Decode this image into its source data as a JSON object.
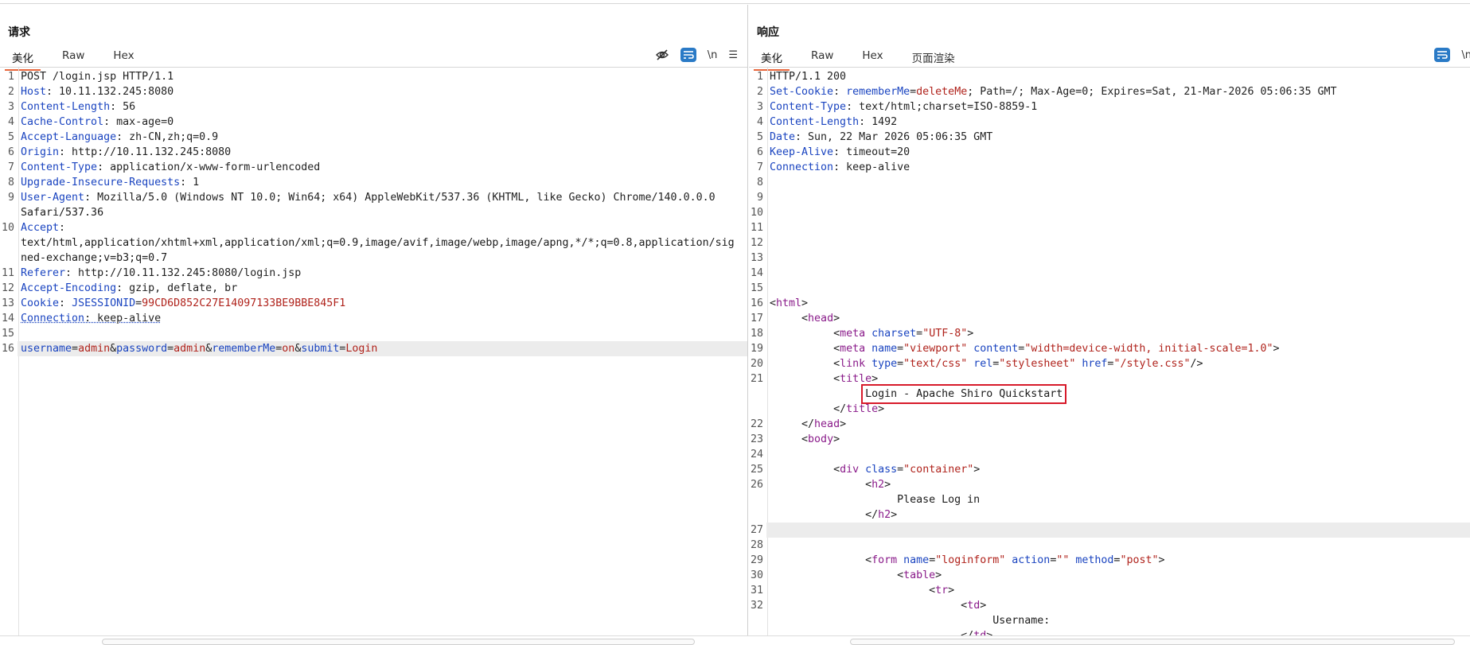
{
  "request": {
    "title": "请求",
    "tabs": [
      "美化",
      "Raw",
      "Hex"
    ],
    "tools": {
      "eye_off": "eye-off-icon",
      "wrap": "wrap-icon",
      "newline": "\\n",
      "menu": "☰"
    },
    "lines": [
      {
        "n": "1",
        "segs": [
          [
            "v",
            "POST /login.jsp HTTP/1.1"
          ]
        ]
      },
      {
        "n": "2",
        "segs": [
          [
            "k",
            "Host"
          ],
          [
            "v",
            ": 10.11.132.245:8080"
          ]
        ]
      },
      {
        "n": "3",
        "segs": [
          [
            "k",
            "Content-Length"
          ],
          [
            "v",
            ": 56"
          ]
        ]
      },
      {
        "n": "4",
        "segs": [
          [
            "k",
            "Cache-Control"
          ],
          [
            "v",
            ": max-age=0"
          ]
        ]
      },
      {
        "n": "5",
        "segs": [
          [
            "k",
            "Accept-Language"
          ],
          [
            "v",
            ": zh-CN,zh;q=0.9"
          ]
        ]
      },
      {
        "n": "6",
        "segs": [
          [
            "k",
            "Origin"
          ],
          [
            "v",
            ": http://10.11.132.245:8080"
          ]
        ]
      },
      {
        "n": "7",
        "segs": [
          [
            "k",
            "Content-Type"
          ],
          [
            "v",
            ": application/x-www-form-urlencoded"
          ]
        ]
      },
      {
        "n": "8",
        "segs": [
          [
            "k",
            "Upgrade-Insecure-Requests"
          ],
          [
            "v",
            ": 1"
          ]
        ]
      },
      {
        "n": "9",
        "segs": [
          [
            "k",
            "User-Agent"
          ],
          [
            "v",
            ": Mozilla/5.0 (Windows NT 10.0; Win64; x64) AppleWebKit/537.36 (KHTML, like Gecko) Chrome/140.0.0.0"
          ]
        ],
        "cont": [
          "Safari/537.36"
        ]
      },
      {
        "n": "10",
        "segs": [
          [
            "k",
            "Accept"
          ],
          [
            "v",
            ":"
          ]
        ],
        "cont": [
          "text/html,application/xhtml+xml,application/xml;q=0.9,image/avif,image/webp,image/apng,*/*;q=0.8,application/sig",
          "ned-exchange;v=b3;q=0.7"
        ]
      },
      {
        "n": "11",
        "segs": [
          [
            "k",
            "Referer"
          ],
          [
            "v",
            ": http://10.11.132.245:8080/login.jsp"
          ]
        ]
      },
      {
        "n": "12",
        "segs": [
          [
            "k",
            "Accept-Encoding"
          ],
          [
            "v",
            ": gzip, deflate, br"
          ]
        ]
      },
      {
        "n": "13",
        "segs": [
          [
            "k",
            "Cookie"
          ],
          [
            "v",
            ": "
          ],
          [
            "k",
            "JSESSIONID"
          ],
          [
            "v",
            "="
          ],
          [
            "r",
            "99CD6D852C27E14097133BE9BBE845F1"
          ]
        ]
      },
      {
        "n": "14",
        "segs": [
          [
            "k ul",
            "Connection"
          ],
          [
            "v ul",
            ": keep-alive"
          ]
        ]
      },
      {
        "n": "15",
        "segs": [
          [
            "v",
            ""
          ]
        ]
      },
      {
        "n": "16",
        "hl": true,
        "segs": [
          [
            "k",
            "username"
          ],
          [
            "v",
            "="
          ],
          [
            "r",
            "admin"
          ],
          [
            "v",
            "&"
          ],
          [
            "k",
            "password"
          ],
          [
            "v",
            "="
          ],
          [
            "r",
            "admin"
          ],
          [
            "v",
            "&"
          ],
          [
            "k",
            "rememberMe"
          ],
          [
            "v",
            "="
          ],
          [
            "r",
            "on"
          ],
          [
            "v",
            "&"
          ],
          [
            "k",
            "submit"
          ],
          [
            "v",
            "="
          ],
          [
            "r",
            "Login"
          ]
        ]
      }
    ]
  },
  "response": {
    "title": "响应",
    "tabs": [
      "美化",
      "Raw",
      "Hex",
      "页面渲染"
    ],
    "tools": {
      "wrap": "wrap-icon",
      "newline": "\\n"
    },
    "lines": [
      {
        "n": "1",
        "segs": [
          [
            "v",
            "HTTP/1.1 200"
          ]
        ]
      },
      {
        "n": "2",
        "segs": [
          [
            "k",
            "Set-Cookie"
          ],
          [
            "v",
            ": "
          ],
          [
            "k",
            "rememberMe"
          ],
          [
            "v",
            "="
          ],
          [
            "r",
            "deleteMe"
          ],
          [
            "v",
            "; Path=/; Max-Age=0; Expires=Sat, 21-Mar-2026 05:06:35 GMT"
          ]
        ]
      },
      {
        "n": "3",
        "segs": [
          [
            "k",
            "Content-Type"
          ],
          [
            "v",
            ": text/html;charset=ISO-8859-1"
          ]
        ]
      },
      {
        "n": "4",
        "segs": [
          [
            "k",
            "Content-Length"
          ],
          [
            "v",
            ": 1492"
          ]
        ]
      },
      {
        "n": "5",
        "segs": [
          [
            "k",
            "Date"
          ],
          [
            "v",
            ": Sun, 22 Mar 2026 05:06:35 GMT"
          ]
        ]
      },
      {
        "n": "6",
        "segs": [
          [
            "k",
            "Keep-Alive"
          ],
          [
            "v",
            ": timeout=20"
          ]
        ]
      },
      {
        "n": "7",
        "segs": [
          [
            "k",
            "Connection"
          ],
          [
            "v",
            ": keep-alive"
          ]
        ]
      },
      {
        "n": "8",
        "segs": [
          [
            "v",
            ""
          ]
        ]
      },
      {
        "n": "9",
        "segs": [
          [
            "v",
            ""
          ]
        ]
      },
      {
        "n": "10",
        "segs": [
          [
            "v",
            ""
          ]
        ]
      },
      {
        "n": "11",
        "segs": [
          [
            "v",
            ""
          ]
        ]
      },
      {
        "n": "12",
        "segs": [
          [
            "v",
            ""
          ]
        ]
      },
      {
        "n": "13",
        "segs": [
          [
            "v",
            ""
          ]
        ]
      },
      {
        "n": "14",
        "segs": [
          [
            "v",
            ""
          ]
        ]
      },
      {
        "n": "15",
        "segs": [
          [
            "v",
            ""
          ]
        ]
      },
      {
        "n": "16",
        "segs": [
          [
            "p",
            "<"
          ],
          [
            "tag",
            "html"
          ],
          [
            "p",
            ">"
          ]
        ]
      },
      {
        "n": "17",
        "segs": [
          [
            "v",
            "     "
          ],
          [
            "p",
            "<"
          ],
          [
            "tag",
            "head"
          ],
          [
            "p",
            ">"
          ]
        ]
      },
      {
        "n": "18",
        "segs": [
          [
            "v",
            "          "
          ],
          [
            "p",
            "<"
          ],
          [
            "tag",
            "meta"
          ],
          [
            "v",
            " "
          ],
          [
            "attr",
            "charset"
          ],
          [
            "p",
            "="
          ],
          [
            "val",
            "\"UTF-8\""
          ],
          [
            "p",
            ">"
          ]
        ]
      },
      {
        "n": "19",
        "segs": [
          [
            "v",
            "          "
          ],
          [
            "p",
            "<"
          ],
          [
            "tag",
            "meta"
          ],
          [
            "v",
            " "
          ],
          [
            "attr",
            "name"
          ],
          [
            "p",
            "="
          ],
          [
            "val",
            "\"viewport\""
          ],
          [
            "v",
            " "
          ],
          [
            "attr",
            "content"
          ],
          [
            "p",
            "="
          ],
          [
            "val",
            "\"width=device-width, initial-scale=1.0\""
          ],
          [
            "p",
            ">"
          ]
        ]
      },
      {
        "n": "20",
        "segs": [
          [
            "v",
            "          "
          ],
          [
            "p",
            "<"
          ],
          [
            "tag",
            "link"
          ],
          [
            "v",
            " "
          ],
          [
            "attr",
            "type"
          ],
          [
            "p",
            "="
          ],
          [
            "val",
            "\"text/css\""
          ],
          [
            "v",
            " "
          ],
          [
            "attr",
            "rel"
          ],
          [
            "p",
            "="
          ],
          [
            "val",
            "\"stylesheet\""
          ],
          [
            "v",
            " "
          ],
          [
            "attr",
            "href"
          ],
          [
            "p",
            "="
          ],
          [
            "val",
            "\"/style.css\""
          ],
          [
            "p",
            "/>"
          ]
        ]
      },
      {
        "n": "21",
        "segs": [
          [
            "v",
            "          "
          ],
          [
            "p",
            "<"
          ],
          [
            "tag",
            "title"
          ],
          [
            "p",
            ">"
          ]
        ],
        "cont": [
          "               @@BOX@@Login - Apache Shiro Quickstart"
        ],
        "cont2": [
          [
            "v",
            "          "
          ],
          [
            "p",
            "</"
          ],
          [
            "tag",
            "title"
          ],
          [
            "p",
            ">"
          ]
        ]
      },
      {
        "n": "22",
        "segs": [
          [
            "v",
            "     "
          ],
          [
            "p",
            "</"
          ],
          [
            "tag",
            "head"
          ],
          [
            "p",
            ">"
          ]
        ]
      },
      {
        "n": "23",
        "segs": [
          [
            "v",
            "     "
          ],
          [
            "p",
            "<"
          ],
          [
            "tag",
            "body"
          ],
          [
            "p",
            ">"
          ]
        ]
      },
      {
        "n": "24",
        "segs": [
          [
            "v",
            ""
          ]
        ]
      },
      {
        "n": "25",
        "segs": [
          [
            "v",
            "          "
          ],
          [
            "p",
            "<"
          ],
          [
            "tag",
            "div"
          ],
          [
            "v",
            " "
          ],
          [
            "attr",
            "class"
          ],
          [
            "p",
            "="
          ],
          [
            "val",
            "\"container\""
          ],
          [
            "p",
            ">"
          ]
        ]
      },
      {
        "n": "26",
        "segs": [
          [
            "v",
            "               "
          ],
          [
            "p",
            "<"
          ],
          [
            "tag",
            "h2"
          ],
          [
            "p",
            ">"
          ]
        ],
        "cont": [
          "                    Please Log in"
        ],
        "cont2": [
          [
            "v",
            "               "
          ],
          [
            "p",
            "</"
          ],
          [
            "tag",
            "h2"
          ],
          [
            "p",
            ">"
          ]
        ]
      },
      {
        "n": "27",
        "hl": true,
        "segs": [
          [
            "v",
            ""
          ]
        ]
      },
      {
        "n": "28",
        "segs": [
          [
            "v",
            ""
          ]
        ]
      },
      {
        "n": "29",
        "segs": [
          [
            "v",
            "               "
          ],
          [
            "p",
            "<"
          ],
          [
            "tag",
            "form"
          ],
          [
            "v",
            " "
          ],
          [
            "attr",
            "name"
          ],
          [
            "p",
            "="
          ],
          [
            "val",
            "\"loginform\""
          ],
          [
            "v",
            " "
          ],
          [
            "attr",
            "action"
          ],
          [
            "p",
            "="
          ],
          [
            "val",
            "\"\""
          ],
          [
            "v",
            " "
          ],
          [
            "attr",
            "method"
          ],
          [
            "p",
            "="
          ],
          [
            "val",
            "\"post\""
          ],
          [
            "p",
            ">"
          ]
        ]
      },
      {
        "n": "30",
        "segs": [
          [
            "v",
            "                    "
          ],
          [
            "p",
            "<"
          ],
          [
            "tag",
            "table"
          ],
          [
            "p",
            ">"
          ]
        ]
      },
      {
        "n": "31",
        "segs": [
          [
            "v",
            "                         "
          ],
          [
            "p",
            "<"
          ],
          [
            "tag",
            "tr"
          ],
          [
            "p",
            ">"
          ]
        ]
      },
      {
        "n": "32",
        "segs": [
          [
            "v",
            "                              "
          ],
          [
            "p",
            "<"
          ],
          [
            "tag",
            "td"
          ],
          [
            "p",
            ">"
          ]
        ],
        "cont": [
          "                                   Username:"
        ],
        "cont2": [
          [
            "v",
            "                              "
          ],
          [
            "p",
            "</"
          ],
          [
            "tag",
            "td"
          ],
          [
            "p",
            ">"
          ]
        ]
      }
    ]
  },
  "colors": {
    "accent": "#e8673c",
    "blue": "#2a7ac6",
    "highlight_box": "#d71a2a"
  }
}
